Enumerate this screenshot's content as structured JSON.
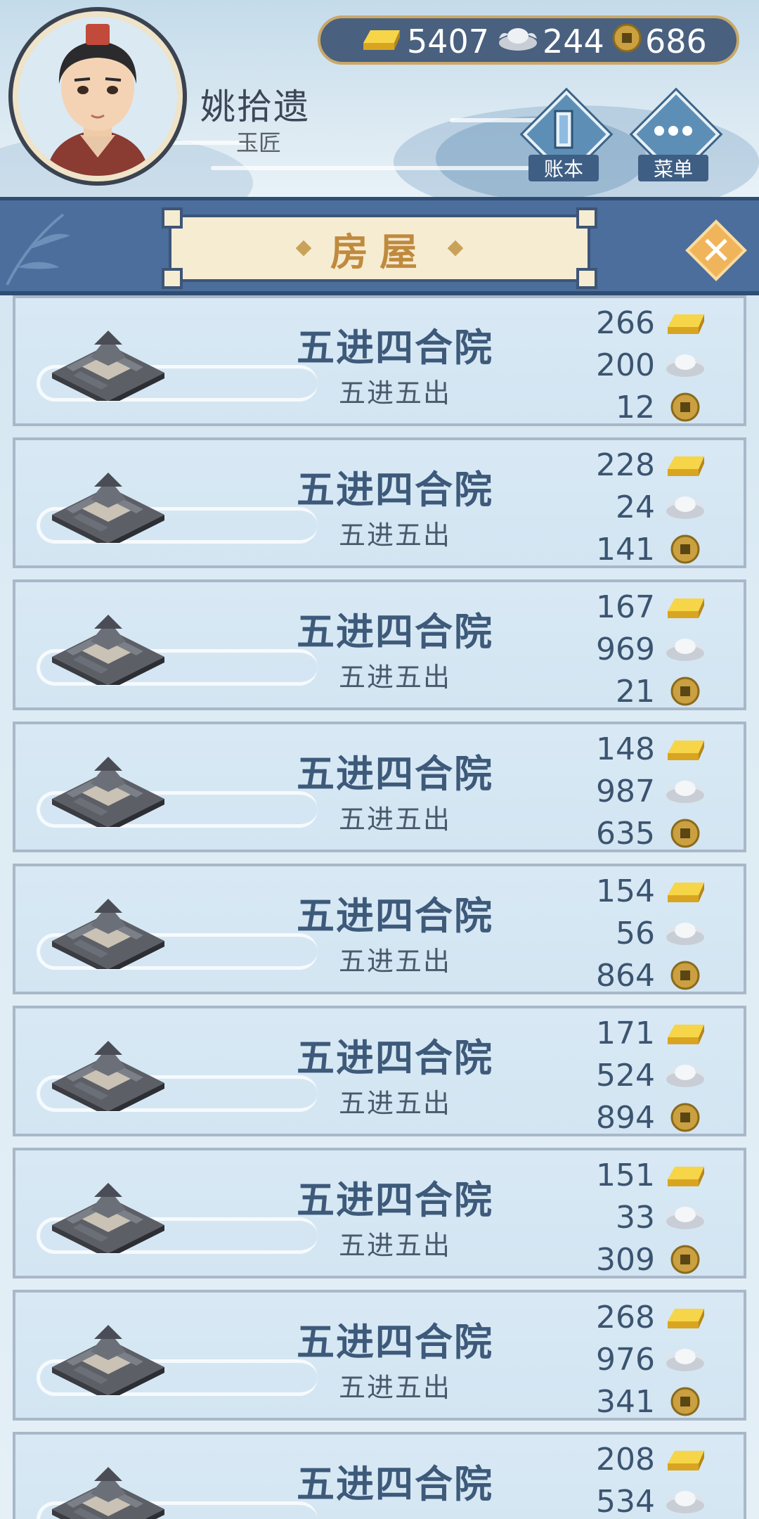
{
  "player": {
    "name": "姚拾遗",
    "title": "玉匠"
  },
  "currency": {
    "gold": "5407",
    "silver": "244",
    "coin": "686"
  },
  "buttons": {
    "ledger": "账本",
    "menu": "菜单"
  },
  "panel": {
    "title": "房屋"
  },
  "houses": [
    {
      "name": "五进四合院",
      "desc": "五进五出",
      "gold": "266",
      "silver": "200",
      "coin": "12"
    },
    {
      "name": "五进四合院",
      "desc": "五进五出",
      "gold": "228",
      "silver": "24",
      "coin": "141"
    },
    {
      "name": "五进四合院",
      "desc": "五进五出",
      "gold": "167",
      "silver": "969",
      "coin": "21"
    },
    {
      "name": "五进四合院",
      "desc": "五进五出",
      "gold": "148",
      "silver": "987",
      "coin": "635"
    },
    {
      "name": "五进四合院",
      "desc": "五进五出",
      "gold": "154",
      "silver": "56",
      "coin": "864"
    },
    {
      "name": "五进四合院",
      "desc": "五进五出",
      "gold": "171",
      "silver": "524",
      "coin": "894"
    },
    {
      "name": "五进四合院",
      "desc": "五进五出",
      "gold": "151",
      "silver": "33",
      "coin": "309"
    },
    {
      "name": "五进四合院",
      "desc": "五进五出",
      "gold": "268",
      "silver": "976",
      "coin": "341"
    },
    {
      "name": "五进四合院",
      "desc": "",
      "gold": "208",
      "silver": "534",
      "coin": ""
    }
  ]
}
